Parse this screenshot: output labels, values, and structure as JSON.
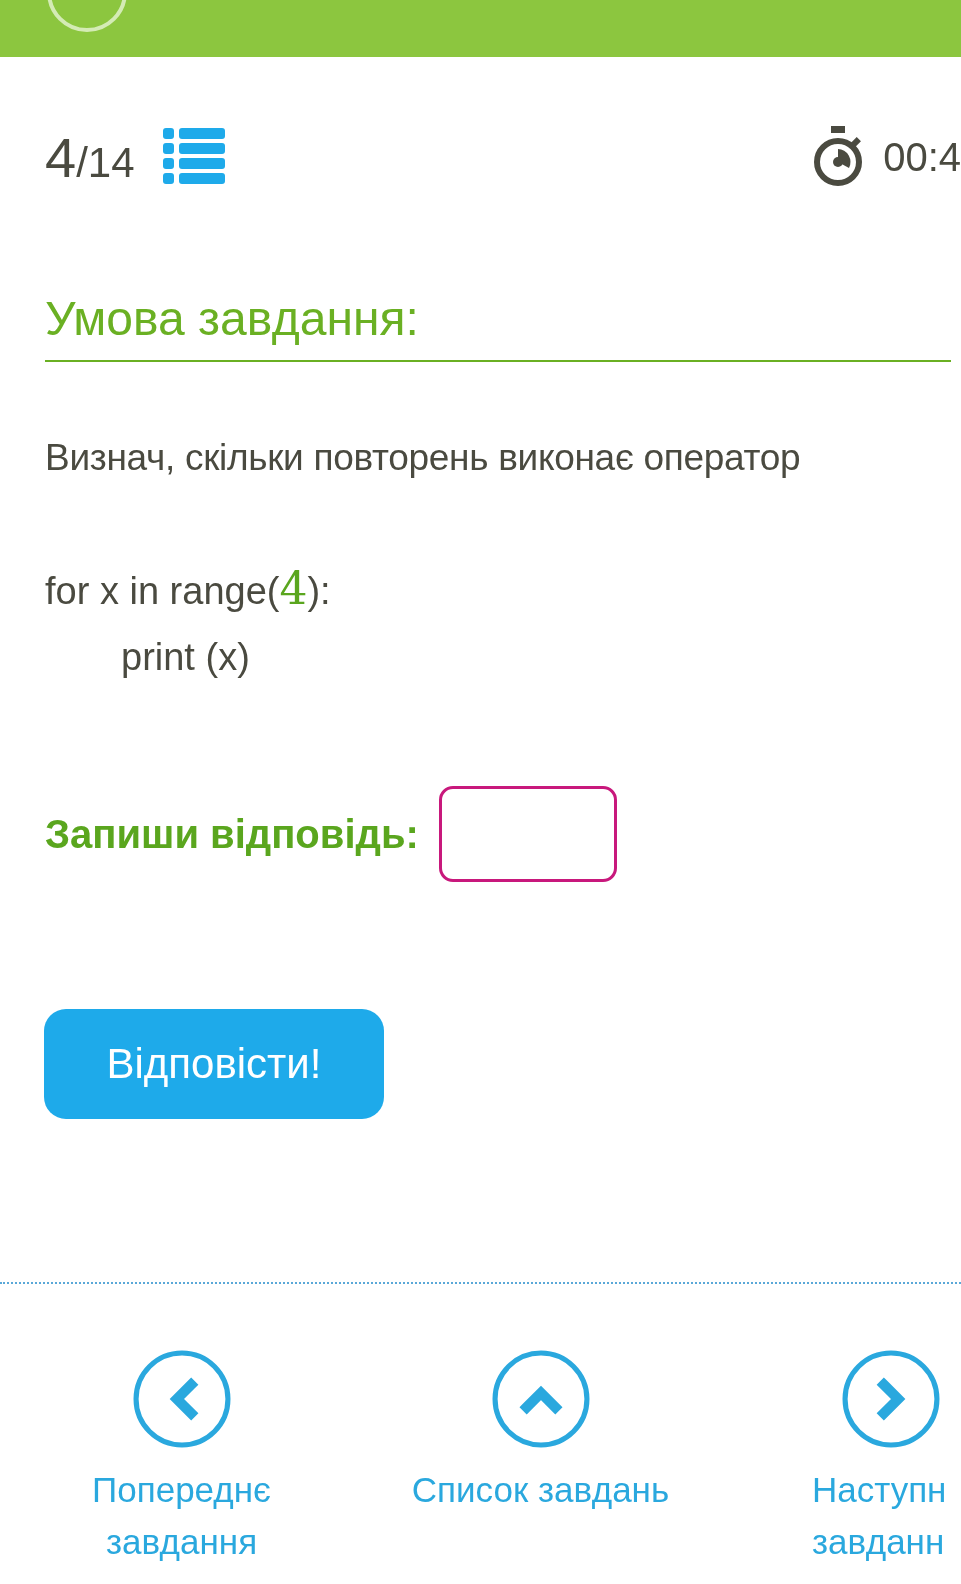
{
  "header": {
    "current": "4",
    "total": "/14",
    "timer": "00:4"
  },
  "task": {
    "title": "Умова завдання:",
    "question": "Визнач, скільки повторень виконає оператор",
    "code": [
      {
        "text": "for x in range(",
        "number": "4",
        "tail": "):",
        "indent": false
      },
      {
        "text": "print (x)",
        "indent": true
      }
    ]
  },
  "answer": {
    "label": "Запиши відповідь:"
  },
  "submit": "Відповісти!",
  "nav": [
    {
      "kind": "left",
      "lines": [
        "Попереднє",
        "завдання"
      ]
    },
    {
      "kind": "up",
      "lines": [
        "Список завдань"
      ]
    },
    {
      "kind": "right",
      "lines": [
        "Наступн",
        "завданн"
      ]
    }
  ]
}
